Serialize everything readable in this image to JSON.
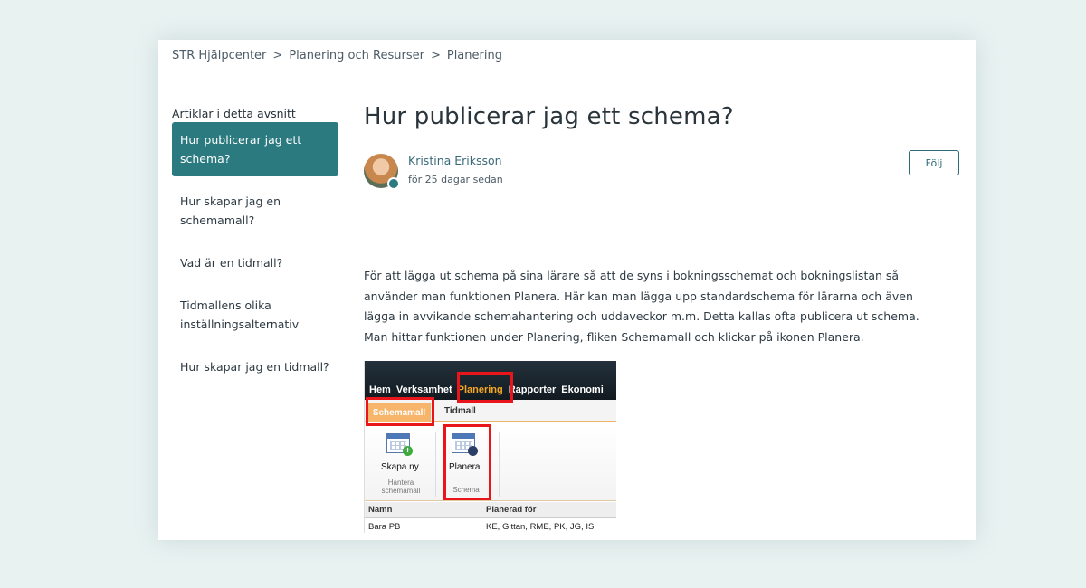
{
  "breadcrumb": [
    "STR Hjälpcenter",
    "Planering och Resurser",
    "Planering"
  ],
  "breadcrumb_separator": ">",
  "sidebar": {
    "title": "Artiklar i detta avsnitt",
    "items": [
      {
        "label": "Hur publicerar jag ett schema?",
        "active": true
      },
      {
        "label": "Hur skapar jag en schemamall?",
        "active": false
      },
      {
        "label": "Vad är en tidmall?",
        "active": false
      },
      {
        "label": "Tidmallens olika inställningsalternativ",
        "active": false
      },
      {
        "label": "Hur skapar jag en tidmall?",
        "active": false
      }
    ]
  },
  "article": {
    "title": "Hur publicerar jag ett schema?",
    "author": "Kristina Eriksson",
    "time": "för 25 dagar sedan",
    "follow_label": "Följ",
    "body": "För att lägga ut schema på sina lärare så att de syns i bokningsschemat och bokningslistan så använder man funktionen Planera. Här kan man lägga upp standardschema för lärarna och även lägga in avvikande schemahantering och uddaveckor m.m. Detta kallas ofta publicera ut schema. Man hittar funktionen under Planering, fliken Schemamall och klickar på ikonen Planera."
  },
  "screenshot": {
    "menu": [
      "Hem",
      "Verksamhet",
      "Planering",
      "Rapporter",
      "Ekonomi"
    ],
    "tabs": [
      "Schemamall",
      "Tidmall"
    ],
    "ribbon_buttons": [
      {
        "label": "Skapa ny",
        "group": "Hantera schemamall"
      },
      {
        "label": "Planera",
        "group": "Schema"
      }
    ],
    "table_headers": [
      "Namn",
      "Planerad för"
    ],
    "table_rows": [
      [
        "Bara PB",
        "KE, Gittan, RME, PK, JG, IS"
      ]
    ]
  },
  "colors": {
    "page_bg": "#e8f2f1",
    "accent": "#2a7a80",
    "highlight_box": "#e8151b",
    "menu_highlight": "#f5a623"
  },
  "icons": [
    "user-badge-icon",
    "calendar-add-icon",
    "calendar-person-icon"
  ]
}
